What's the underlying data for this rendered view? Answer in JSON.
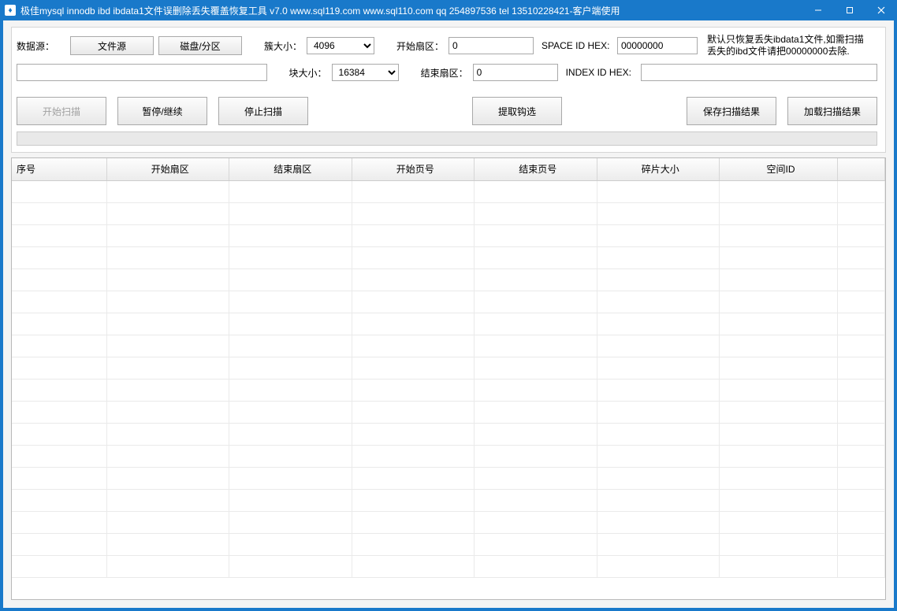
{
  "window": {
    "title": "极佳mysql innodb ibd ibdata1文件误删除丢失覆盖恢复工具 v7.0 www.sql119.com www.sql110.com qq 254897536 tel 13510228421-客户端使用"
  },
  "controls": {
    "data_source_label": "数据源：",
    "file_source_btn": "文件源",
    "disk_partition_btn": "磁盘/分区",
    "cluster_size_label": "簇大小：",
    "cluster_size_value": "4096",
    "block_size_label": "块大小：",
    "block_size_value": "16384",
    "start_sector_label": "开始扇区：",
    "start_sector_value": "0",
    "end_sector_label": "结束扇区：",
    "end_sector_value": "0",
    "space_id_hex_label": "SPACE ID HEX:",
    "space_id_hex_value": "00000000",
    "index_id_hex_label": "INDEX ID HEX:",
    "index_id_hex_value": "",
    "note_text": "默认只恢复丢失ibdata1文件,如需扫描丢失的ibd文件请把00000000去除.",
    "path_value": ""
  },
  "buttons": {
    "start_scan": "开始扫描",
    "pause_resume": "暂停/继续",
    "stop_scan": "停止扫描",
    "extract_check": "提取钩选",
    "save_results": "保存扫描结果",
    "load_results": "加载扫描结果"
  },
  "table": {
    "columns": [
      "序号",
      "开始扇区",
      "结束扇区",
      "开始页号",
      "结束页号",
      "碎片大小",
      "空间ID"
    ],
    "rows": []
  }
}
